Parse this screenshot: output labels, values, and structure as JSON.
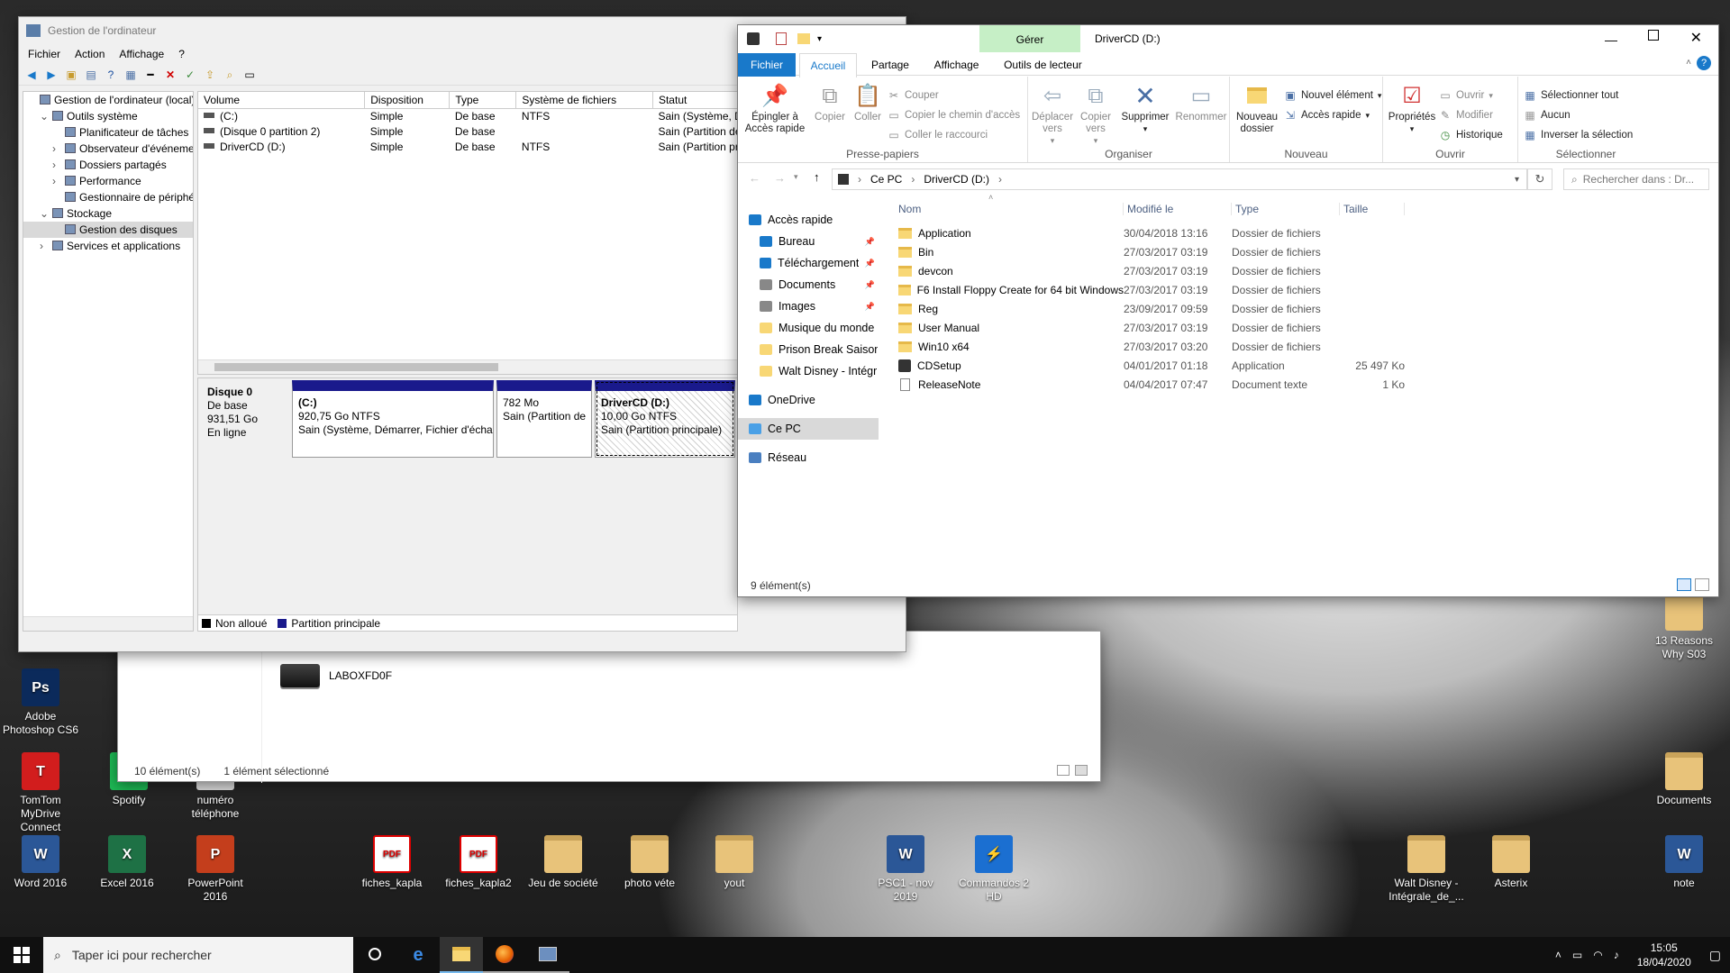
{
  "desktop": {
    "icons": [
      {
        "label": "Adobe Photoshop CS6",
        "icon": "photoshop-icon",
        "color": "#0b2a5b",
        "glyph": "Ps"
      },
      {
        "label": "TomTom MyDrive Connect",
        "icon": "tomtom-icon",
        "color": "#d21d1d",
        "glyph": "T"
      },
      {
        "label": "Word 2016",
        "icon": "word-icon",
        "color": "#2b5797",
        "glyph": "W"
      },
      {
        "label": "Spotify",
        "icon": "spotify-icon",
        "color": "#1db954",
        "glyph": "♫"
      },
      {
        "label": "Excel 2016",
        "icon": "excel-icon",
        "color": "#1e7145",
        "glyph": "X"
      },
      {
        "label": "numéro téléphone",
        "icon": "text-file-icon",
        "color": "#dddddd",
        "glyph": ""
      },
      {
        "label": "PowerPoint 2016",
        "icon": "powerpoint-icon",
        "color": "#c43e1c",
        "glyph": "P"
      },
      {
        "label": "fiches_kapla",
        "icon": "pdf-icon",
        "color": "#ffffff",
        "glyph": "PDF"
      },
      {
        "label": "fiches_kapla2",
        "icon": "pdf-icon",
        "color": "#ffffff",
        "glyph": "PDF"
      },
      {
        "label": "Jeu de société",
        "icon": "folder-icon",
        "color": "#e8c37a",
        "glyph": ""
      },
      {
        "label": "photo véte",
        "icon": "folder-icon",
        "color": "#e8c37a",
        "glyph": ""
      },
      {
        "label": "yout",
        "icon": "folder-icon",
        "color": "#e8c37a",
        "glyph": ""
      },
      {
        "label": "PSC1 - nov 2019",
        "icon": "word-doc-icon",
        "color": "#2b5797",
        "glyph": "W"
      },
      {
        "label": "Commandos 2 HD",
        "icon": "steam-app-icon",
        "color": "#1b6fd1",
        "glyph": "⚡"
      },
      {
        "label": "Walt Disney - Intégrale_de_...",
        "icon": "folder-icon",
        "color": "#e8c37a",
        "glyph": ""
      },
      {
        "label": "Asterix",
        "icon": "folder-icon",
        "color": "#e8c37a",
        "glyph": ""
      },
      {
        "label": "13 Reasons Why S03",
        "icon": "folder-icon",
        "color": "#e8c37a",
        "glyph": ""
      },
      {
        "label": "Documents",
        "icon": "folder-icon",
        "color": "#e8c37a",
        "glyph": ""
      },
      {
        "label": "note",
        "icon": "word-doc-icon",
        "color": "#2b5797",
        "glyph": "W"
      }
    ]
  },
  "comp_mgmt": {
    "title": "Gestion de l'ordinateur",
    "menu": [
      "Fichier",
      "Action",
      "Affichage",
      "?"
    ],
    "tree": [
      {
        "label": "Gestion de l'ordinateur (local)",
        "icon": "computer-mgmt-icon"
      },
      {
        "label": "Outils système",
        "icon": "tools-icon"
      },
      {
        "label": "Planificateur de tâches",
        "icon": "clock-icon"
      },
      {
        "label": "Observateur d'événeme",
        "icon": "event-viewer-icon"
      },
      {
        "label": "Dossiers partagés",
        "icon": "shared-folder-icon"
      },
      {
        "label": "Performance",
        "icon": "performance-icon"
      },
      {
        "label": "Gestionnaire de périphé",
        "icon": "device-manager-icon"
      },
      {
        "label": "Stockage",
        "icon": "storage-icon"
      },
      {
        "label": "Gestion des disques",
        "icon": "disk-mgmt-icon"
      },
      {
        "label": "Services et applications",
        "icon": "services-icon"
      }
    ],
    "columns": [
      "Volume",
      "Disposition",
      "Type",
      "Système de fichiers",
      "Statut"
    ],
    "rows": [
      [
        "(C:)",
        "Simple",
        "De base",
        "NTFS",
        "Sain (Système, Démarrer, Fichier d'échang"
      ],
      [
        "(Disque 0 partition 2)",
        "Simple",
        "De base",
        "",
        "Sain (Partition de récupération)"
      ],
      [
        "DriverCD (D:)",
        "Simple",
        "De base",
        "NTFS",
        "Sain (Partition principale)"
      ]
    ],
    "disk": {
      "name": "Disque 0",
      "type": "De base",
      "size": "931,51 Go",
      "state": "En ligne"
    },
    "partitions": [
      {
        "title": "(C:)",
        "size": "920,75 Go NTFS",
        "status": "Sain (Système, Démarrer, Fichier d'échar"
      },
      {
        "title": "",
        "size": "782 Mo",
        "status": "Sain (Partition de"
      },
      {
        "title": "DriverCD  (D:)",
        "size": "10,00 Go NTFS",
        "status": "Sain (Partition principale)"
      }
    ],
    "legend": [
      {
        "label": "Non alloué",
        "color": "#000000"
      },
      {
        "label": "Partition principale",
        "color": "#1a1a8c"
      }
    ]
  },
  "back_explorer": {
    "item": "LABOXFD0F",
    "status_count": "10 élément(s)",
    "status_selected": "1 élément sélectionné"
  },
  "explorer": {
    "title": "DriverCD (D:)",
    "contextual_tab": "Gérer",
    "tabs": [
      "Fichier",
      "Accueil",
      "Partage",
      "Affichage",
      "Outils de lecteur"
    ],
    "ribbon": {
      "pin": "Épingler à Accès rapide",
      "copy": "Copier",
      "paste": "Coller",
      "cut": "Couper",
      "copy_path": "Copier le chemin d'accès",
      "paste_shortcut": "Coller le raccourci",
      "group_clipboard": "Presse-papiers",
      "move_to": "Déplacer vers",
      "copy_to": "Copier vers",
      "delete": "Supprimer",
      "rename": "Renommer",
      "group_organize": "Organiser",
      "new_folder": "Nouveau dossier",
      "new_item": "Nouvel élément",
      "easy_access": "Accès rapide",
      "group_new": "Nouveau",
      "properties": "Propriétés",
      "open": "Ouvrir",
      "edit": "Modifier",
      "history": "Historique",
      "group_open": "Ouvrir",
      "select_all": "Sélectionner tout",
      "select_none": "Aucun",
      "invert": "Inverser la sélection",
      "group_select": "Sélectionner"
    },
    "breadcrumb": [
      "Ce PC",
      "DriverCD (D:)"
    ],
    "search_placeholder": "Rechercher dans : Dr...",
    "nav": [
      {
        "label": "Accès rapide",
        "icon": "star-icon",
        "pinned": false
      },
      {
        "label": "Bureau",
        "icon": "desktop-icon",
        "pinned": true
      },
      {
        "label": "Téléchargements",
        "icon": "download-icon",
        "pinned": true
      },
      {
        "label": "Documents",
        "icon": "documents-icon",
        "pinned": true
      },
      {
        "label": "Images",
        "icon": "images-icon",
        "pinned": true
      },
      {
        "label": "Musique du monde",
        "icon": "folder-icon",
        "pinned": false
      },
      {
        "label": "Prison Break Saison",
        "icon": "folder-icon",
        "pinned": false
      },
      {
        "label": "Walt Disney - Intégr",
        "icon": "folder-icon",
        "pinned": false
      },
      {
        "label": "OneDrive",
        "icon": "onedrive-icon",
        "pinned": false
      },
      {
        "label": "Ce PC",
        "icon": "this-pc-icon",
        "pinned": false
      },
      {
        "label": "Réseau",
        "icon": "network-icon",
        "pinned": false
      }
    ],
    "columns": [
      "Nom",
      "Modifié le",
      "Type",
      "Taille"
    ],
    "files": [
      {
        "name": "Application",
        "date": "30/04/2018 13:16",
        "type": "Dossier de fichiers",
        "size": "",
        "kind": "folder"
      },
      {
        "name": "Bin",
        "date": "27/03/2017 03:19",
        "type": "Dossier de fichiers",
        "size": "",
        "kind": "folder"
      },
      {
        "name": "devcon",
        "date": "27/03/2017 03:19",
        "type": "Dossier de fichiers",
        "size": "",
        "kind": "folder"
      },
      {
        "name": "F6 Install Floppy Create for 64 bit Windows",
        "date": "27/03/2017 03:19",
        "type": "Dossier de fichiers",
        "size": "",
        "kind": "folder"
      },
      {
        "name": "Reg",
        "date": "23/09/2017 09:59",
        "type": "Dossier de fichiers",
        "size": "",
        "kind": "folder"
      },
      {
        "name": "User Manual",
        "date": "27/03/2017 03:19",
        "type": "Dossier de fichiers",
        "size": "",
        "kind": "folder"
      },
      {
        "name": "Win10 x64",
        "date": "27/03/2017 03:20",
        "type": "Dossier de fichiers",
        "size": "",
        "kind": "folder"
      },
      {
        "name": "CDSetup",
        "date": "04/01/2017 01:18",
        "type": "Application",
        "size": "25 497 Ko",
        "kind": "app"
      },
      {
        "name": "ReleaseNote",
        "date": "04/04/2017 07:47",
        "type": "Document texte",
        "size": "1 Ko",
        "kind": "text"
      }
    ],
    "status": "9 élément(s)"
  },
  "taskbar": {
    "search_placeholder": "Taper ici pour rechercher",
    "time": "15:05",
    "date": "18/04/2020"
  },
  "colors": {
    "accent": "#1979ca",
    "gerer": "#c6efc6",
    "partition_bar": "#1a1a8c"
  }
}
